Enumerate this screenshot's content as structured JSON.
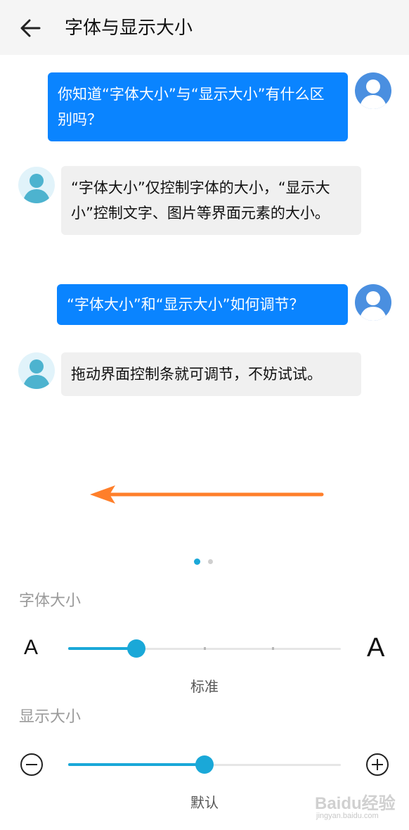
{
  "header": {
    "title": "字体与显示大小",
    "back_icon": "arrow-left-icon"
  },
  "chat": [
    {
      "role": "user",
      "text": "你知道“字体大小”与“显示大小”有什么区别吗？"
    },
    {
      "role": "bot",
      "text": "“字体大小”仅控制字体的大小，“显示大小”控制文字、图片等界面元素的大小。"
    },
    {
      "role": "user",
      "text": "“字体大小”和“显示大小”如何调节？"
    },
    {
      "role": "bot",
      "text": "拖动界面控制条就可调节，不妨试试。"
    }
  ],
  "swipe_hint": {
    "icon": "arrow-left-icon",
    "color": "#ff7f2a"
  },
  "pager": {
    "count": 2,
    "active_index": 0
  },
  "font_size": {
    "label": "字体大小",
    "small_glyph": "A",
    "large_glyph": "A",
    "value_label": "标准",
    "steps": 5,
    "current_step": 1
  },
  "display_size": {
    "label": "显示大小",
    "value_label": "默认",
    "level": 0.5,
    "minus_icon": "minus-circle-icon",
    "plus_icon": "plus-circle-icon"
  },
  "watermark": {
    "main": "Baidu经验",
    "sub": "jingyan.baidu.com"
  },
  "colors": {
    "accent": "#1aa8d8",
    "user_bubble": "#0a84ff",
    "bot_bubble": "#f0f0f0",
    "arrow": "#ff7f2a"
  }
}
